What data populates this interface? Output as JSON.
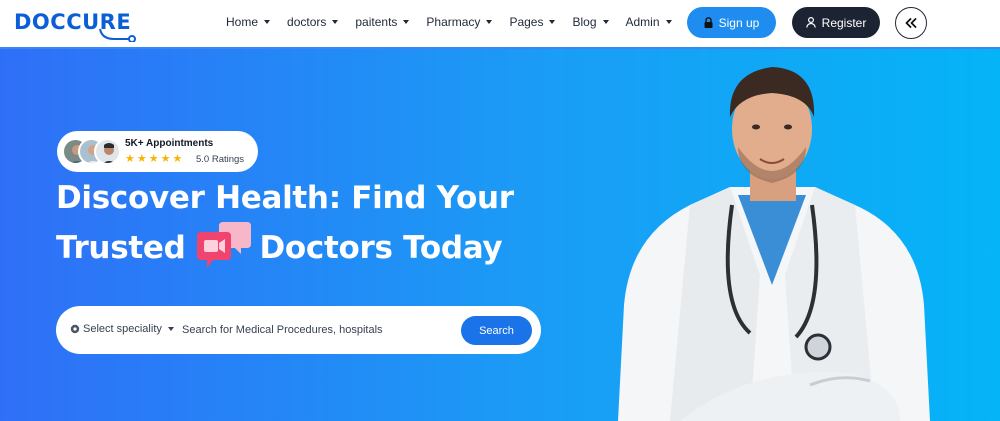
{
  "brand": {
    "name": "DOCCURE",
    "logo_color": "#0b5fd6"
  },
  "nav": {
    "items": [
      {
        "label": "Home"
      },
      {
        "label": "doctors"
      },
      {
        "label": "paitents"
      },
      {
        "label": "Pharmacy"
      },
      {
        "label": "Pages"
      },
      {
        "label": "Blog"
      },
      {
        "label": "Admin"
      }
    ]
  },
  "header": {
    "signup_label": "Sign up",
    "signup_icon": "lock-icon",
    "register_label": "Register",
    "register_icon": "user-icon",
    "collapse_icon": "double-chevron-left-icon",
    "signup_color": "#1f8cf0",
    "register_color": "#1c2434"
  },
  "hero": {
    "appointments": "5K+ Appointments",
    "rating_stars": 5,
    "ratings_text": "5.0 Ratings",
    "title_line1": "Discover Health: Find Your",
    "title_line2_a": "Trusted",
    "title_line2_b": "Doctors Today",
    "gradient_start": "#2f6ff7",
    "gradient_end": "#05b4f7"
  },
  "search": {
    "specialty_label": "Select speciality",
    "placeholder": "Search for Medical Procedures, hospitals",
    "button_label": "Search"
  }
}
